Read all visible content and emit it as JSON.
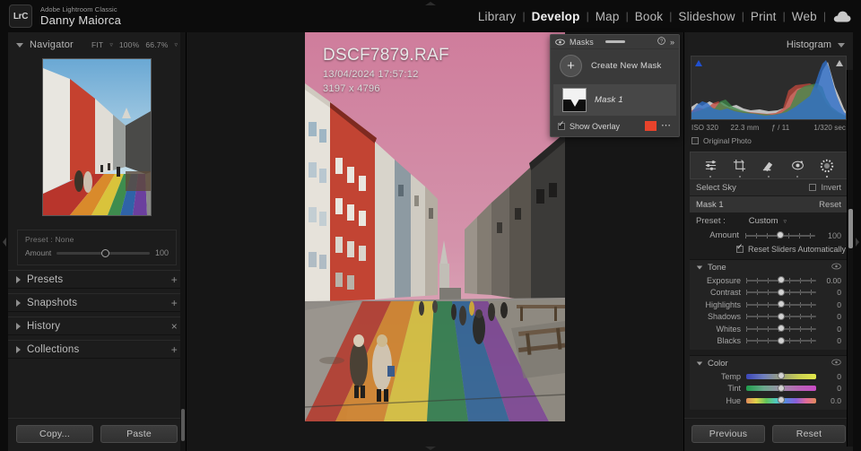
{
  "app": {
    "brand_logo": "LrC",
    "brand_app": "Adobe Lightroom Classic",
    "brand_user": "Danny Maiorca"
  },
  "modules": {
    "items": [
      {
        "label": "Library",
        "active": false
      },
      {
        "label": "Develop",
        "active": true
      },
      {
        "label": "Map",
        "active": false
      },
      {
        "label": "Book",
        "active": false
      },
      {
        "label": "Slideshow",
        "active": false
      },
      {
        "label": "Print",
        "active": false
      },
      {
        "label": "Web",
        "active": false
      }
    ],
    "separator": "|",
    "cloud_icon": "cloud-icon"
  },
  "left_panel": {
    "navigator": {
      "title": "Navigator",
      "fit_label": "FIT",
      "zoom_100": "100%",
      "zoom_667": "66.7%"
    },
    "preset_box": {
      "preset_label": "Preset : None",
      "amount_label": "Amount",
      "amount_value": "100"
    },
    "sections": [
      {
        "label": "Presets",
        "action": "+"
      },
      {
        "label": "Snapshots",
        "action": "+"
      },
      {
        "label": "History",
        "action": "×"
      },
      {
        "label": "Collections",
        "action": "+"
      }
    ],
    "buttons": {
      "copy": "Copy...",
      "paste": "Paste"
    }
  },
  "photo_info": {
    "filename": "DSCF7879.RAF",
    "datetime": "13/04/2024 17:57:12",
    "dimensions": "3197 x 4796"
  },
  "masks_panel": {
    "title": "Masks",
    "eye_icon": "eye-icon",
    "help_icon": "help-icon",
    "collapse_icon": "chevron-double-right-icon",
    "create_new_mask": "Create New Mask",
    "plus_icon": "plus-icon",
    "mask_name": "Mask 1",
    "show_overlay": "Show Overlay",
    "overlay_color": "#e8432b",
    "more_icon": "more-options-icon"
  },
  "right_panel": {
    "histogram": {
      "title": "Histogram",
      "shadow_clip_icon": "shadow-clipping-icon",
      "highlight_clip_icon": "highlight-clipping-icon"
    },
    "exif": {
      "iso": "ISO 320",
      "focal": "22.3 mm",
      "aperture": "ƒ / 11",
      "shutter": "1/320 sec"
    },
    "original_photo": "Original Photo",
    "tools": [
      {
        "name": "basic-adjust-icon",
        "active": false
      },
      {
        "name": "crop-overlay-icon",
        "active": false
      },
      {
        "name": "spot-removal-icon",
        "active": false
      },
      {
        "name": "red-eye-icon",
        "active": false
      },
      {
        "name": "masking-icon",
        "active": true
      }
    ],
    "select_sky": "Select Sky",
    "invert": "Invert",
    "mask_header": {
      "name": "Mask 1",
      "reset": "Reset"
    },
    "preset_row": {
      "label": "Preset :",
      "value": "Custom"
    },
    "amount_row": {
      "label": "Amount",
      "value": "100"
    },
    "reset_sliders": "Reset Sliders Automatically",
    "tone": {
      "title": "Tone",
      "eye_icon": "visibility-icon",
      "sliders": [
        {
          "label": "Exposure",
          "value": "0.00",
          "pos": 50
        },
        {
          "label": "Contrast",
          "value": "0",
          "pos": 50
        },
        {
          "label": "Highlights",
          "value": "0",
          "pos": 50
        },
        {
          "label": "Shadows",
          "value": "0",
          "pos": 50
        },
        {
          "label": "Whites",
          "value": "0",
          "pos": 50
        },
        {
          "label": "Blacks",
          "value": "0",
          "pos": 50
        }
      ]
    },
    "color": {
      "title": "Color",
      "eye_icon": "visibility-icon",
      "sliders": [
        {
          "label": "Temp",
          "value": "0",
          "pos": 50
        },
        {
          "label": "Tint",
          "value": "0",
          "pos": 50
        },
        {
          "label": "Hue",
          "value": "0.0",
          "pos": 50
        }
      ]
    },
    "buttons": {
      "previous": "Previous",
      "reset": "Reset"
    }
  }
}
